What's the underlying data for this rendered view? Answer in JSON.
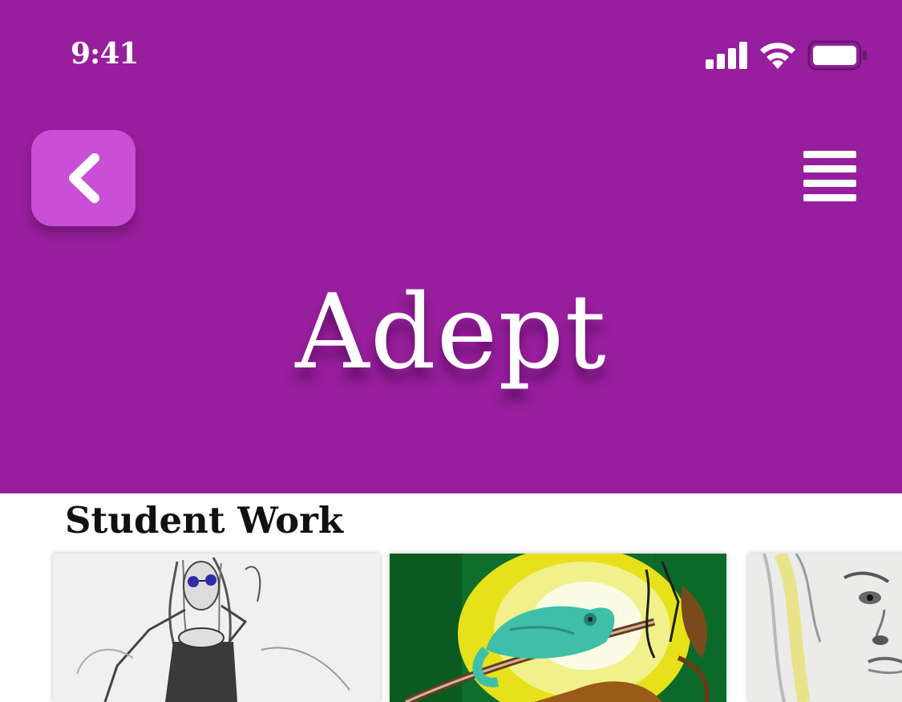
{
  "status_bar": {
    "time": "9:41",
    "icons": [
      "signal-icon",
      "wifi-icon",
      "battery-icon"
    ]
  },
  "header": {
    "background_color": "#971e9c",
    "back_button_color": "#c84fd6",
    "back_icon": "chevron-left-icon",
    "menu_icon": "hamburger-menu-icon",
    "title": "Adept"
  },
  "section": {
    "title": "Student Work"
  },
  "gallery": {
    "items": [
      {
        "name": "artwork-sketch-girl-sunglasses",
        "description_icon": "pencil-drawing-image"
      },
      {
        "name": "artwork-chameleon-painting",
        "description_icon": "painting-image"
      },
      {
        "name": "artwork-face-portrait",
        "description_icon": "pencil-drawing-image"
      }
    ]
  }
}
